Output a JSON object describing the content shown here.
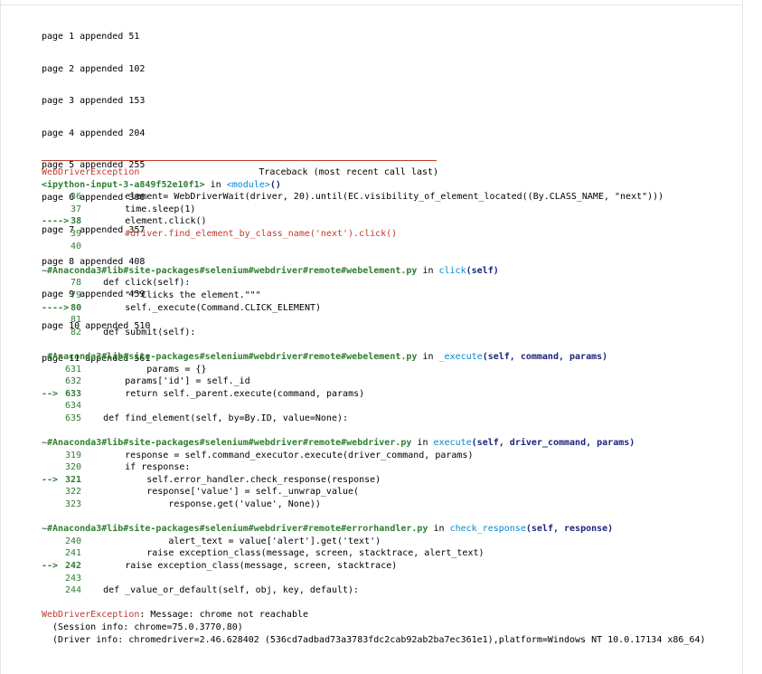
{
  "appended": [
    "page 1 appended 51",
    "page 2 appended 102",
    "page 3 appended 153",
    "page 4 appended 204",
    "page 5 appended 255",
    "page 6 appended 306",
    "page 7 appended 357",
    "page 8 appended 408",
    "page 9 appended 459",
    "page 10 appended 510",
    "page 11 appended 561"
  ],
  "traceback": {
    "exception_name": "WebDriverException",
    "header_right": "Traceback (most recent call last)",
    "input_ref": "<ipython-input-3-a849f52e10f1>",
    "in_word": " in ",
    "module": "<module>",
    "module_suffix": "()",
    "frame1": [
      {
        "num": "36",
        "arrow": "",
        "code": "        element= WebDriverWait(driver, 20).until(EC.visibility_of_element_located((By.CLASS_NAME, \"next\")))"
      },
      {
        "num": "37",
        "arrow": "",
        "code": "        time.sleep(1)"
      },
      {
        "num": "38",
        "arrow": "---->",
        "code": "        element.click()"
      },
      {
        "num": "39",
        "arrow": "",
        "code": "        #driver.find_element_by_class_name('next').click()"
      },
      {
        "num": "40",
        "arrow": "",
        "code": ""
      }
    ],
    "frame2_path": "~#Anaconda3#lib#site-packages#selenium#webdriver#remote#webelement.py",
    "frame2_func": "click",
    "frame2_args": "(self)",
    "frame2": [
      {
        "num": "78",
        "arrow": "",
        "code": "    def click(self):"
      },
      {
        "num": "79",
        "arrow": "",
        "code": "        \"\"\"Clicks the element.\"\"\""
      },
      {
        "num": "80",
        "arrow": "---->",
        "code": "        self._execute(Command.CLICK_ELEMENT)"
      },
      {
        "num": "81",
        "arrow": "",
        "code": ""
      },
      {
        "num": "82",
        "arrow": "",
        "code": "    def submit(self):"
      }
    ],
    "frame3_path": "~#Anaconda3#lib#site-packages#selenium#webdriver#remote#webelement.py",
    "frame3_func": "_execute",
    "frame3_args": "(self, command, params)",
    "frame3": [
      {
        "num": "631",
        "arrow": "",
        "code": "            params = {}"
      },
      {
        "num": "632",
        "arrow": "",
        "code": "        params['id'] = self._id"
      },
      {
        "num": "633",
        "arrow": "-->",
        "code": "        return self._parent.execute(command, params)"
      },
      {
        "num": "634",
        "arrow": "",
        "code": ""
      },
      {
        "num": "635",
        "arrow": "",
        "code": "    def find_element(self, by=By.ID, value=None):"
      }
    ],
    "frame4_path": "~#Anaconda3#lib#site-packages#selenium#webdriver#remote#webdriver.py",
    "frame4_func": "execute",
    "frame4_args": "(self, driver_command, params)",
    "frame4": [
      {
        "num": "319",
        "arrow": "",
        "code": "        response = self.command_executor.execute(driver_command, params)"
      },
      {
        "num": "320",
        "arrow": "",
        "code": "        if response:"
      },
      {
        "num": "321",
        "arrow": "-->",
        "code": "            self.error_handler.check_response(response)"
      },
      {
        "num": "322",
        "arrow": "",
        "code": "            response['value'] = self._unwrap_value("
      },
      {
        "num": "323",
        "arrow": "",
        "code": "                response.get('value', None))"
      }
    ],
    "frame5_path": "~#Anaconda3#lib#site-packages#selenium#webdriver#remote#errorhandler.py",
    "frame5_func": "check_response",
    "frame5_args": "(self, response)",
    "frame5": [
      {
        "num": "240",
        "arrow": "",
        "code": "                alert_text = value['alert'].get('text')"
      },
      {
        "num": "241",
        "arrow": "",
        "code": "            raise exception_class(message, screen, stacktrace, alert_text)"
      },
      {
        "num": "242",
        "arrow": "-->",
        "code": "        raise exception_class(message, screen, stacktrace)"
      },
      {
        "num": "243",
        "arrow": "",
        "code": ""
      },
      {
        "num": "244",
        "arrow": "",
        "code": "    def _value_or_default(self, obj, key, default):"
      }
    ],
    "final_message": ": Message: chrome not reachable",
    "session_info": "  (Session info: chrome=75.0.3770.80)",
    "driver_info": "  (Driver info: chromedriver=2.46.628402 (536cd7adbad73a3783fdc2cab92ab2ba7ec361e1),platform=Windows NT 10.0.17134 x86_64)"
  }
}
